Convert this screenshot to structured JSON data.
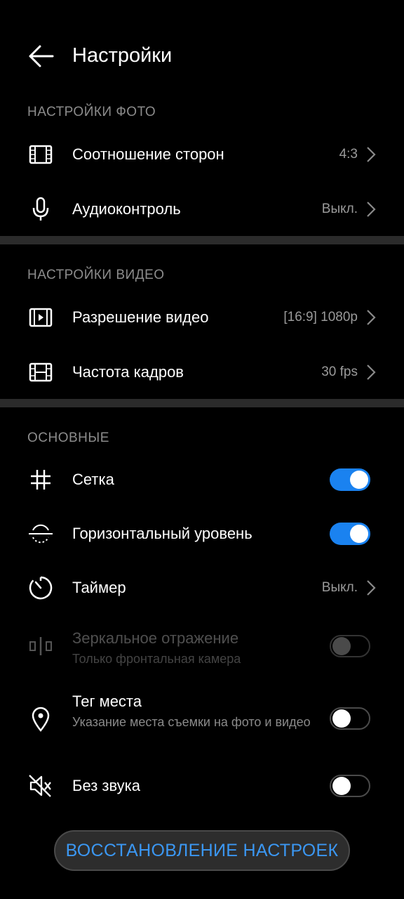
{
  "header": {
    "title": "Настройки",
    "back_icon": "arrow-left-icon"
  },
  "photo_section": {
    "title": "НАСТРОЙКИ ФОТО",
    "items": [
      {
        "label": "Соотношение сторон",
        "value": "4:3",
        "icon": "aspect-ratio-icon"
      },
      {
        "label": "Аудиоконтроль",
        "value": "Выкл.",
        "icon": "microphone-icon"
      }
    ]
  },
  "video_section": {
    "title": "НАСТРОЙКИ ВИДЕО",
    "items": [
      {
        "label": "Разрешение видео",
        "value": "[16:9] 1080p",
        "icon": "video-resolution-icon"
      },
      {
        "label": "Частота кадров",
        "value": "30 fps",
        "icon": "film-icon"
      }
    ]
  },
  "general_section": {
    "title": "ОСНОВНЫЕ",
    "items": [
      {
        "label": "Сетка",
        "toggle": true,
        "icon": "grid-icon"
      },
      {
        "label": "Горизонтальный уровень",
        "toggle": true,
        "icon": "horizon-level-icon"
      },
      {
        "label": "Таймер",
        "value": "Выкл.",
        "icon": "timer-icon"
      },
      {
        "label": "Зеркальное отражение",
        "sublabel": "Только фронтальная камера",
        "toggle": false,
        "disabled": true,
        "icon": "mirror-icon"
      },
      {
        "label": "Тег места",
        "sublabel": "Указание места съемки на фото и видео",
        "toggle": false,
        "icon": "location-pin-icon"
      },
      {
        "label": "Без звука",
        "toggle": false,
        "icon": "mute-icon"
      }
    ]
  },
  "reset_button": {
    "label": "ВОССТАНОВЛЕНИЕ НАСТРОЕК"
  },
  "colors": {
    "accent": "#1a82f0",
    "button_text": "#3b97f2",
    "background": "#000000",
    "divider": "#2b2b2b"
  }
}
